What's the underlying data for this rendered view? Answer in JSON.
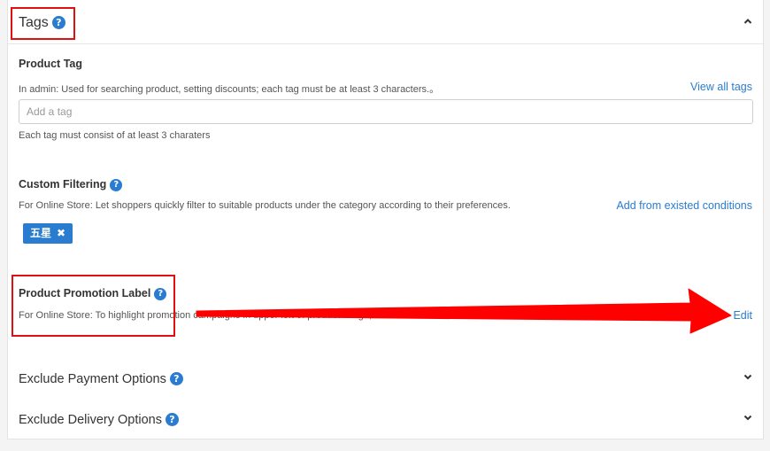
{
  "tags_section": {
    "title": "Tags",
    "help_glyph": "?"
  },
  "product_tag": {
    "title": "Product Tag",
    "hint": "In admin: Used for searching product, setting discounts; each tag must be at least 3 characters.。",
    "view_all_link": "View all tags",
    "input_placeholder": "Add a tag",
    "input_value": "",
    "footnote": "Each tag must consist of at least 3 charaters"
  },
  "custom_filtering": {
    "title": "Custom Filtering",
    "hint": "For Online Store: Let shoppers quickly filter to suitable products under the category according to their preferences.",
    "add_link": "Add from existed conditions",
    "chips": [
      {
        "label": "五星",
        "remove_glyph": "✖"
      }
    ]
  },
  "promotion_label": {
    "title": "Product Promotion Label",
    "hint": "For Online Store: To highlight promotion campaigns in upper left of product image,",
    "edit_link": "Edit"
  },
  "exclude_payment": {
    "title": "Exclude Payment Options"
  },
  "exclude_delivery": {
    "title": "Exclude Delivery Options"
  },
  "annotation": {
    "highlight_color": "#e01010",
    "arrow_color": "#ff0000"
  }
}
